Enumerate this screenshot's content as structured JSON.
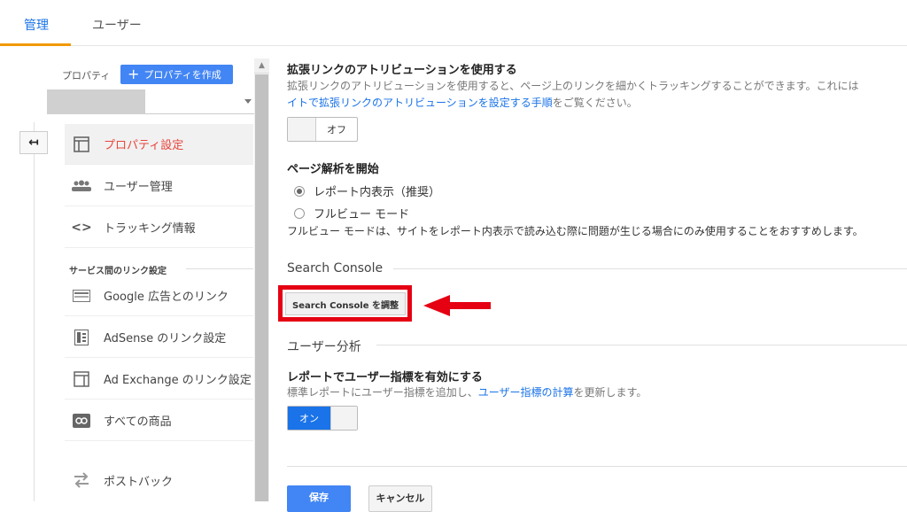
{
  "tabs": [
    {
      "label": "管理",
      "active": true
    },
    {
      "label": "ユーザー",
      "active": false
    }
  ],
  "sidebar": {
    "property_label": "プロパティ",
    "create_button": "プロパティを作成",
    "items": [
      {
        "label": "プロパティ設定",
        "icon": "window-icon",
        "active": true
      },
      {
        "label": "ユーザー管理",
        "icon": "users-icon"
      },
      {
        "label": "トラッキング情報",
        "icon": "code-icon"
      }
    ],
    "section_label": "サービス間のリンク設定",
    "link_items": [
      {
        "label": "Google 広告とのリンク",
        "icon": "ads-icon"
      },
      {
        "label": "AdSense のリンク設定",
        "icon": "adsense-icon"
      },
      {
        "label": "Ad Exchange のリンク設定",
        "icon": "adexchange-icon"
      },
      {
        "label": "すべての商品",
        "icon": "link-icon"
      },
      {
        "label": "ポストバック",
        "icon": "postback-icon"
      }
    ]
  },
  "enhanced_link": {
    "title": "拡張リンクのアトリビューションを使用する",
    "desc_line1": "拡張リンクのアトリビューションを使用すると、ページ上のリンクを細かくトラッキングすることができます。これには",
    "desc_link": "イトで拡張リンクのアトリビューションを設定する手順",
    "desc_tail": "をご覧ください。",
    "toggle_label": "オフ"
  },
  "page_analysis": {
    "title": "ページ解析を開始",
    "option1": "レポート内表示（推奨）",
    "option2": "フルビュー モード",
    "note": "フルビュー モードは、サイトをレポート内表示で読み込む際に問題が生じる場合にのみ使用することをおすすめします。"
  },
  "search_console": {
    "section_title": "Search Console",
    "button_label": "Search Console を調整"
  },
  "user_analysis": {
    "section_title": "ユーザー分析",
    "title": "レポートでユーザー指標を有効にする",
    "desc_pre": "標準レポートにユーザー指標を追加し、",
    "desc_link": "ユーザー指標の計算",
    "desc_post": "を更新します。",
    "toggle_label": "オン"
  },
  "footer": {
    "save": "保存",
    "cancel": "キャンセル"
  },
  "colors": {
    "accent": "#1a73e8",
    "highlight": "#e50012",
    "active_nav": "#e8453c"
  }
}
